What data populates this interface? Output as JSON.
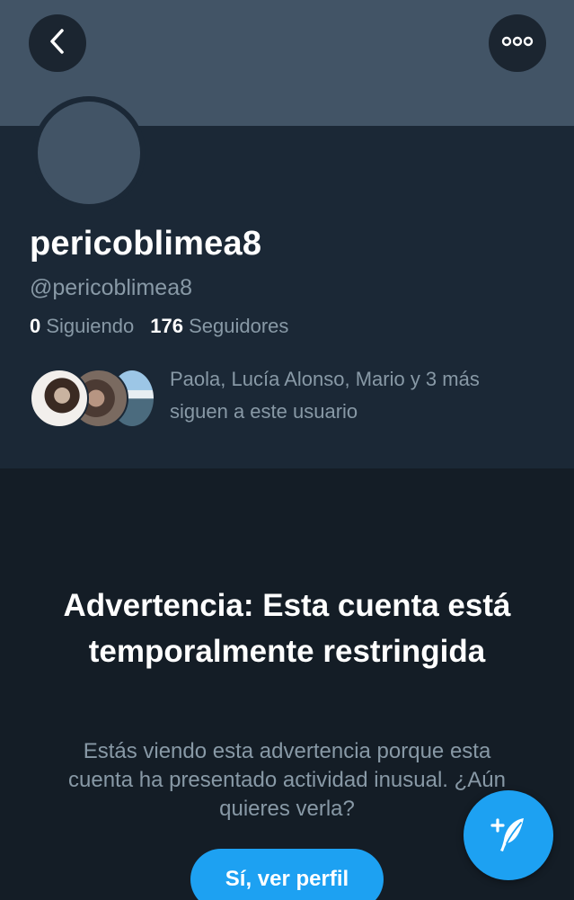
{
  "header": {
    "back_icon": "chevron-left-icon",
    "more_icon": "more-options-icon"
  },
  "profile": {
    "display_name": "pericoblimea8",
    "handle": "@pericoblimea8",
    "following_count": "0",
    "following_label": "Siguiendo",
    "followers_count": "176",
    "followers_label": "Seguidores",
    "followed_by_line1": "Paola, Lucía Alonso, Mario y 3 más",
    "followed_by_line2": "siguen a este usuario"
  },
  "warning": {
    "title": "Advertencia: Esta cuenta está temporalmente restringida",
    "body": "Estás viendo esta advertencia porque esta cuenta ha presentado actividad inusual. ¿Aún quieres verla?",
    "button_label": "Sí, ver perfil"
  },
  "fab": {
    "icon": "compose-tweet-icon"
  },
  "colors": {
    "background": "#141d26",
    "profile_panel": "#1b2836",
    "banner": "#425466",
    "accent": "#1da1f2",
    "secondary_text": "#8899a6"
  }
}
